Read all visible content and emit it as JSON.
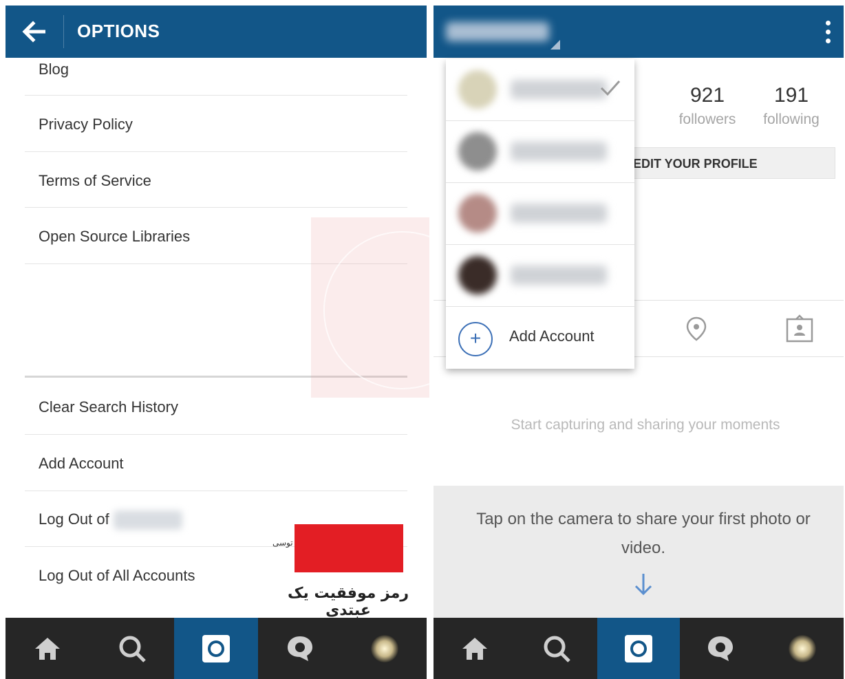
{
  "left": {
    "title": "OPTIONS",
    "menu": {
      "blog": "Blog",
      "privacy": "Privacy Policy",
      "terms": "Terms of Service",
      "open_source": "Open Source Libraries",
      "clear_search": "Clear Search History",
      "add_account": "Add Account",
      "log_out_of": "Log Out of",
      "log_out_all": "Log Out of All Accounts"
    },
    "watermark": {
      "slogan": "رمز موفقیت یک عبتدی",
      "small": "توسی"
    }
  },
  "right": {
    "stats": {
      "followers_count": "921",
      "followers_label": "followers",
      "following_count": "191",
      "following_label": "following"
    },
    "edit_profile": "EDIT YOUR PROFILE",
    "add_account": "Add Account",
    "empty_message": "Start capturing and sharing your moments",
    "tap_message": "Tap on the camera to share your first photo or video."
  },
  "colors": {
    "brand_blue": "#125688",
    "nav_dark": "#262626",
    "accent_red": "#e31e24"
  },
  "icons": [
    "back-arrow-icon",
    "home-icon",
    "search-icon",
    "camera-icon",
    "activity-icon",
    "overflow-menu-icon",
    "location-pin-icon",
    "tagged-photos-icon",
    "checkmark-icon",
    "plus-icon",
    "down-arrow-icon"
  ]
}
